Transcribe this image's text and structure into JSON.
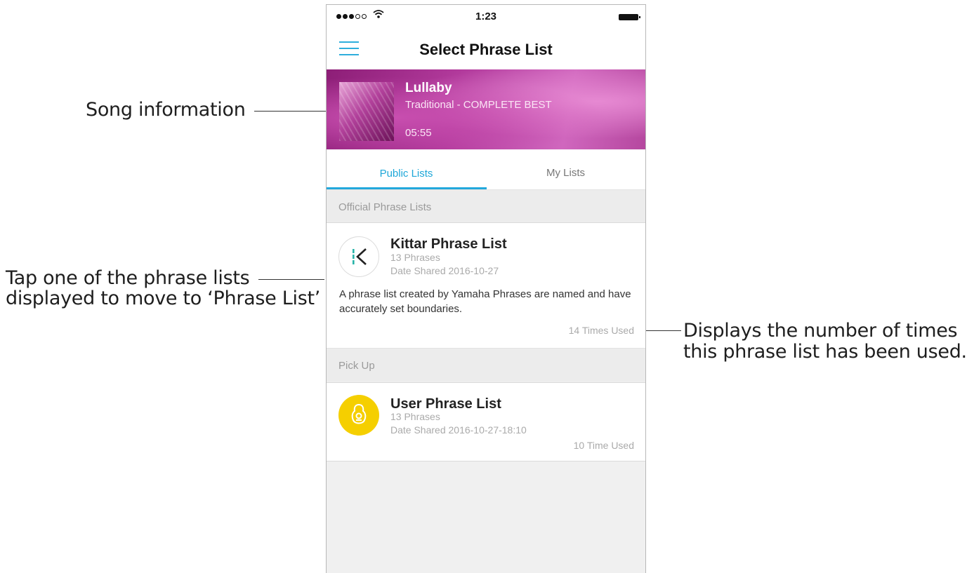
{
  "annotations": {
    "song_info": "Song information",
    "tap_line1": "Tap one of the phrase lists",
    "tap_line2": "displayed to move to  ‘Phrase List’",
    "used_line1": "Displays the number of times",
    "used_line2": "this phrase list has been used."
  },
  "status_bar": {
    "time": "1:23",
    "signal_icon": "signal-dots-icon",
    "wifi_icon": "wifi-icon",
    "battery_icon": "battery-icon"
  },
  "navbar": {
    "title": "Select Phrase List",
    "menu_icon": "hamburger-menu-icon"
  },
  "song": {
    "title": "Lullaby",
    "subtitle": "Traditional - COMPLETE BEST",
    "duration": "05:55"
  },
  "tabs": [
    {
      "label": "Public Lists",
      "active": true
    },
    {
      "label": "My Lists",
      "active": false
    }
  ],
  "sections": {
    "official": "Official Phrase Lists",
    "pickup": "Pick Up"
  },
  "lists": [
    {
      "title": "Kittar Phrase List",
      "phrases": "13 Phrases",
      "date": "Date Shared 2016-10-27",
      "description": "A phrase list created by Yamaha Phrases are named and have accurately set boundaries.",
      "used": "14 Times Used",
      "icon": "kittar-logo-icon"
    },
    {
      "title": "User Phrase List",
      "phrases": "13 Phrases",
      "date": "Date Shared 2016-10-27-18:10",
      "used": "10 Time Used",
      "icon": "guitar-icon"
    }
  ],
  "colors": {
    "accent": "#22a8dc",
    "user_icon": "#f5cf00",
    "kittar_teal": "#27b3a8"
  }
}
